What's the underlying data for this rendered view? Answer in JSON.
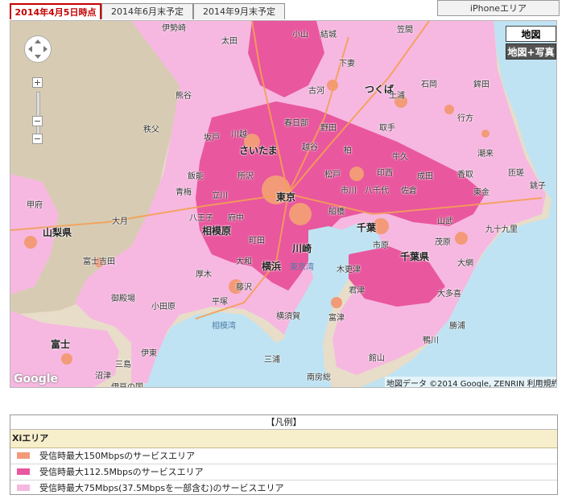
{
  "tabs": [
    {
      "label": "2014年4月5日時点",
      "active": true
    },
    {
      "label": "2014年6月末予定",
      "active": false
    },
    {
      "label": "2014年9月末予定",
      "active": false
    }
  ],
  "right_tab": {
    "label": "iPhoneエリア"
  },
  "map": {
    "type_controls": {
      "map_label": "地図",
      "satellite_label": "地図+写真"
    },
    "attribution": "地図データ ©2014 Google, ZENRIN   利用規約",
    "google_logo": "Google",
    "colors": {
      "sea": "#bfe3f2",
      "land": "#e8ddc9",
      "area_150": "#f39a78",
      "area_112": "#e9579e",
      "area_75": "#f29bd0",
      "mountain": "#cfc3a5"
    },
    "labels": [
      {
        "name": "伊勢崎",
        "size": "normal"
      },
      {
        "name": "太田",
        "size": "normal"
      },
      {
        "name": "小山",
        "size": "normal"
      },
      {
        "name": "結城",
        "size": "normal"
      },
      {
        "name": "笠間",
        "size": "normal"
      },
      {
        "name": "下妻",
        "size": "normal"
      },
      {
        "name": "つくば",
        "size": "big"
      },
      {
        "name": "土浦",
        "size": "normal"
      },
      {
        "name": "石岡",
        "size": "normal"
      },
      {
        "name": "鉾田",
        "size": "normal"
      },
      {
        "name": "熊谷",
        "size": "normal"
      },
      {
        "name": "古河",
        "size": "normal"
      },
      {
        "name": "坂戸",
        "size": "normal"
      },
      {
        "name": "川越",
        "size": "normal"
      },
      {
        "name": "春日部",
        "size": "normal"
      },
      {
        "name": "野田",
        "size": "normal"
      },
      {
        "name": "取手",
        "size": "normal"
      },
      {
        "name": "牛久",
        "size": "normal"
      },
      {
        "name": "行方",
        "size": "normal"
      },
      {
        "name": "潮来",
        "size": "normal"
      },
      {
        "name": "さいたま",
        "size": "big"
      },
      {
        "name": "越谷",
        "size": "normal"
      },
      {
        "name": "柏",
        "size": "normal"
      },
      {
        "name": "成田",
        "size": "normal"
      },
      {
        "name": "香取",
        "size": "normal"
      },
      {
        "name": "秩父",
        "size": "normal"
      },
      {
        "name": "飯能",
        "size": "normal"
      },
      {
        "name": "所沢",
        "size": "normal"
      },
      {
        "name": "松戸",
        "size": "normal"
      },
      {
        "name": "印西",
        "size": "normal"
      },
      {
        "name": "匝瑳",
        "size": "normal"
      },
      {
        "name": "銚子",
        "size": "normal"
      },
      {
        "name": "青梅",
        "size": "normal"
      },
      {
        "name": "立川",
        "size": "normal"
      },
      {
        "name": "東京",
        "size": "big"
      },
      {
        "name": "市川",
        "size": "normal"
      },
      {
        "name": "八千代",
        "size": "normal"
      },
      {
        "name": "佐倉",
        "size": "normal"
      },
      {
        "name": "東金",
        "size": "normal"
      },
      {
        "name": "甲府",
        "size": "normal"
      },
      {
        "name": "八王子",
        "size": "normal"
      },
      {
        "name": "府中",
        "size": "normal"
      },
      {
        "name": "船橋",
        "size": "normal"
      },
      {
        "name": "千葉",
        "size": "big"
      },
      {
        "name": "山武",
        "size": "normal"
      },
      {
        "name": "大月",
        "size": "normal"
      },
      {
        "name": "相模原",
        "size": "big"
      },
      {
        "name": "町田",
        "size": "normal"
      },
      {
        "name": "川崎",
        "size": "big"
      },
      {
        "name": "市原",
        "size": "normal"
      },
      {
        "name": "茂原",
        "size": "normal"
      },
      {
        "name": "山梨県",
        "size": "big"
      },
      {
        "name": "横浜",
        "size": "big"
      },
      {
        "name": "東京湾",
        "size": "sea"
      },
      {
        "name": "大和",
        "size": "normal"
      },
      {
        "name": "木更津",
        "size": "normal"
      },
      {
        "name": "千葉県",
        "size": "big"
      },
      {
        "name": "富士吉田",
        "size": "normal"
      },
      {
        "name": "厚木",
        "size": "normal"
      },
      {
        "name": "藤沢",
        "size": "normal"
      },
      {
        "name": "君津",
        "size": "normal"
      },
      {
        "name": "大多喜",
        "size": "normal"
      },
      {
        "name": "御殿場",
        "size": "normal"
      },
      {
        "name": "平塚",
        "size": "normal"
      },
      {
        "name": "小田原",
        "size": "normal"
      },
      {
        "name": "横須賀",
        "size": "normal"
      },
      {
        "name": "富津",
        "size": "normal"
      },
      {
        "name": "相模湾",
        "size": "sea"
      },
      {
        "name": "三浦",
        "size": "normal"
      },
      {
        "name": "鴨川",
        "size": "normal"
      },
      {
        "name": "富士",
        "size": "big"
      },
      {
        "name": "沼津",
        "size": "normal"
      },
      {
        "name": "三島",
        "size": "normal"
      },
      {
        "name": "伊東",
        "size": "normal"
      },
      {
        "name": "館山",
        "size": "normal"
      },
      {
        "name": "南房総",
        "size": "normal"
      },
      {
        "name": "勝浦",
        "size": "normal"
      },
      {
        "name": "伊豆の国",
        "size": "normal"
      },
      {
        "name": "大網",
        "size": "normal"
      },
      {
        "name": "九十九里",
        "size": "normal"
      }
    ]
  },
  "legend": {
    "title": "【凡例】",
    "section": "Xiエリア",
    "items": [
      {
        "label": "受信時最大150Mbpsのサービスエリア",
        "color": "#f39a78"
      },
      {
        "label": "受信時最大112.5Mbpsのサービスエリア",
        "color": "#e9579e"
      },
      {
        "label": "受信時最大75Mbps(37.5Mbpsを一部含む)のサービスエリア",
        "color": "#f6b8e0"
      }
    ]
  }
}
